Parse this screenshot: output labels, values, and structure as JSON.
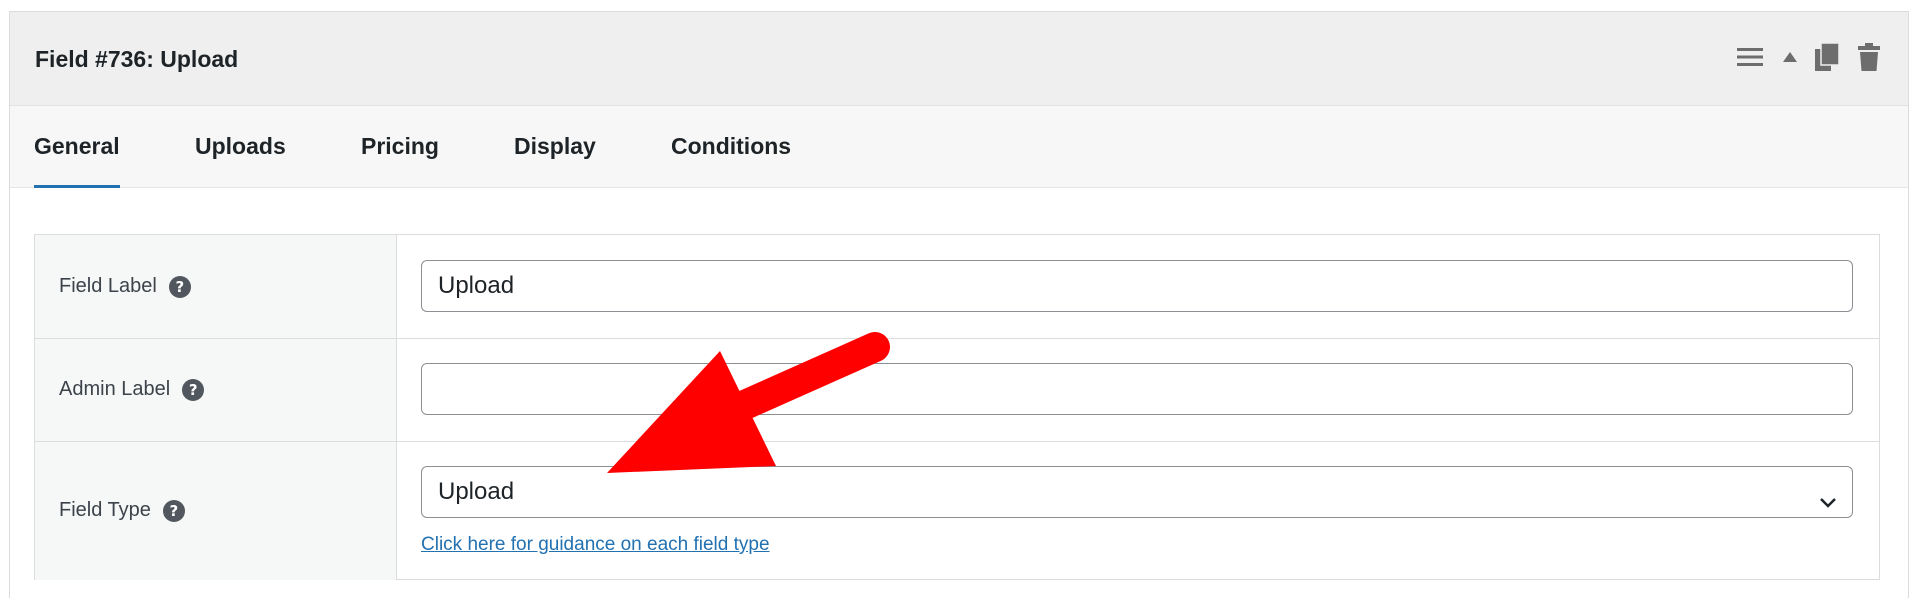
{
  "header": {
    "title": "Field #736: Upload",
    "icons": [
      "menu-icon",
      "collapse-up-icon",
      "duplicate-icon",
      "trash-icon"
    ]
  },
  "tabs": [
    {
      "label": "General",
      "active": true
    },
    {
      "label": "Uploads",
      "active": false
    },
    {
      "label": "Pricing",
      "active": false
    },
    {
      "label": "Display",
      "active": false
    },
    {
      "label": "Conditions",
      "active": false
    }
  ],
  "form": {
    "field_label": {
      "label": "Field Label",
      "value": "Upload"
    },
    "admin_label": {
      "label": "Admin Label",
      "value": ""
    },
    "field_type": {
      "label": "Field Type",
      "value": "Upload",
      "guidance_link": "Click here for guidance on each field type"
    }
  },
  "colors": {
    "accent": "#2271b1",
    "annotation_arrow": "#ff0000",
    "header_bg": "#efefef",
    "tabs_bg": "#f7f7f7",
    "label_cell_bg": "#f6f7f7"
  }
}
